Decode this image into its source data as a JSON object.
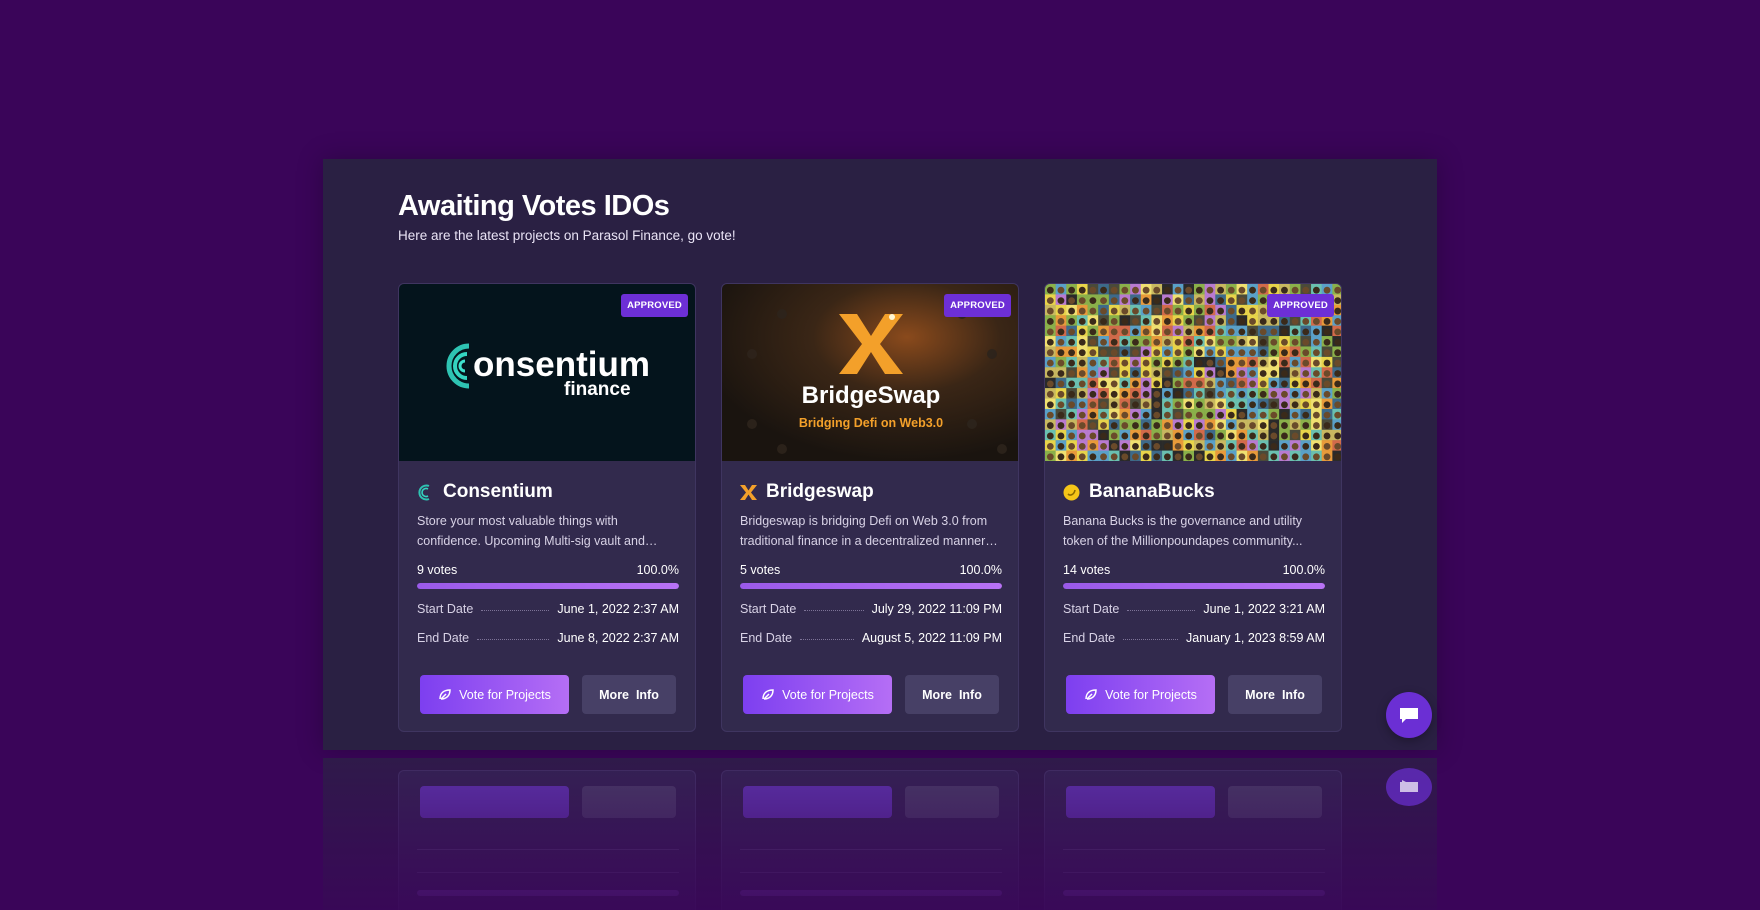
{
  "section": {
    "title": "Awaiting Votes IDOs",
    "subtitle": "Here are the latest projects on Parasol Finance, go vote!"
  },
  "colors": {
    "background": "#3a0559",
    "panel": "#2a2043",
    "card": "#322a4d",
    "accent": "#7d3ff0",
    "badge": "#6d2fd6"
  },
  "labels": {
    "badge": "APPROVED",
    "start_date": "Start Date",
    "end_date": "End Date",
    "vote_button": "Vote for Projects",
    "more_button": "More  Info"
  },
  "projects": [
    {
      "name": "Consentium",
      "icon": "consentium-logo-icon",
      "banner_main": "onsentium",
      "banner_sub": "finance",
      "description": "Store your most valuable things with confidence. Upcoming Multi-sig vault and Escrow platform....",
      "votes": "9 votes",
      "percent": "100.0%",
      "progress": 1.0,
      "start": "June 1, 2022 2:37 AM",
      "end": "June 8, 2022 2:37 AM"
    },
    {
      "name": "Bridgeswap",
      "icon": "bridgeswap-logo-icon",
      "banner_main": "BridgeSwap",
      "banner_sub": "Bridging Defi on Web3.0",
      "description": "Bridgeswap is bridging Defi on Web 3.0 from traditional finance in a decentralized manner t...",
      "votes": "5 votes",
      "percent": "100.0%",
      "progress": 1.0,
      "start": "July 29, 2022 11:09 PM",
      "end": "August 5, 2022 11:09 PM"
    },
    {
      "name": "BananaBucks",
      "icon": "bananabucks-logo-icon",
      "description": "Banana Bucks is the governance and utility token of the Millionpoundapes community...",
      "votes": "14 votes",
      "percent": "100.0%",
      "progress": 1.0,
      "start": "June 1, 2022 3:21 AM",
      "end": "January 1, 2023 8:59 AM"
    }
  ],
  "chat": {
    "icon": "chat-bubble-icon"
  }
}
